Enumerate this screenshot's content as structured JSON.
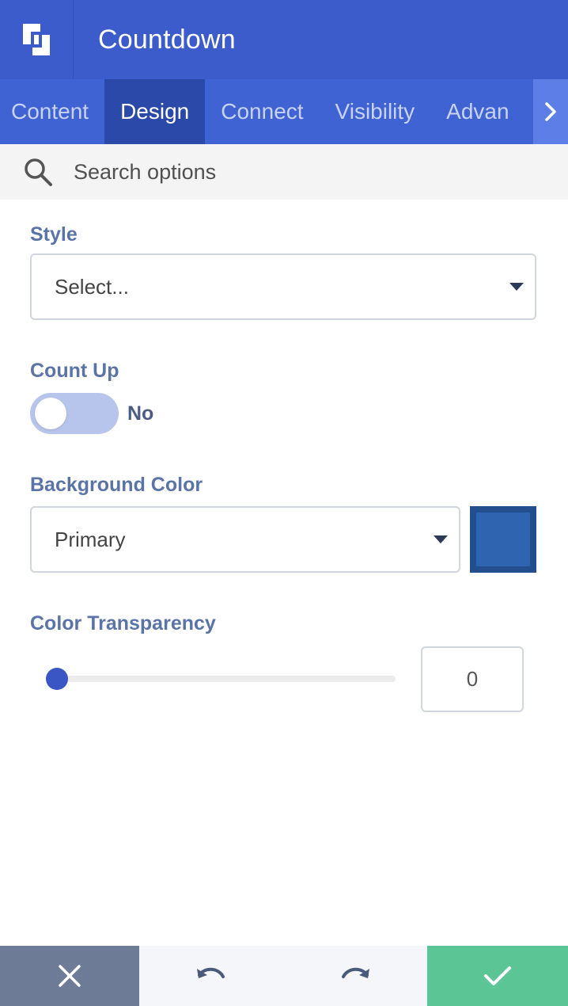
{
  "header": {
    "title": "Countdown",
    "logo_icon": "builder-logo-icon"
  },
  "tabs": [
    {
      "label": "Content",
      "active": false
    },
    {
      "label": "Design",
      "active": true
    },
    {
      "label": "Connect",
      "active": false
    },
    {
      "label": "Visibility",
      "active": false
    },
    {
      "label": "Advan",
      "active": false
    }
  ],
  "tabs_next_icon": "chevron-right-icon",
  "search": {
    "placeholder": "Search options",
    "value": ""
  },
  "form": {
    "style": {
      "label": "Style",
      "value": "Select..."
    },
    "count_up": {
      "label": "Count Up",
      "state": "No",
      "enabled": false
    },
    "background_color": {
      "label": "Background Color",
      "value": "Primary",
      "swatch_color": "#2f64b0"
    },
    "color_transparency": {
      "label": "Color Transparency",
      "value": "0"
    }
  },
  "footer": {
    "cancel_icon": "close-icon",
    "undo_icon": "undo-icon",
    "redo_icon": "redo-icon",
    "confirm_icon": "check-icon"
  },
  "colors": {
    "header": "#3d5ccc",
    "tabs": "#3f63d2",
    "tab_active": "#2b49a8",
    "label": "#5a74a8",
    "cancel": "#6d7b96",
    "confirm": "#5cc596"
  }
}
